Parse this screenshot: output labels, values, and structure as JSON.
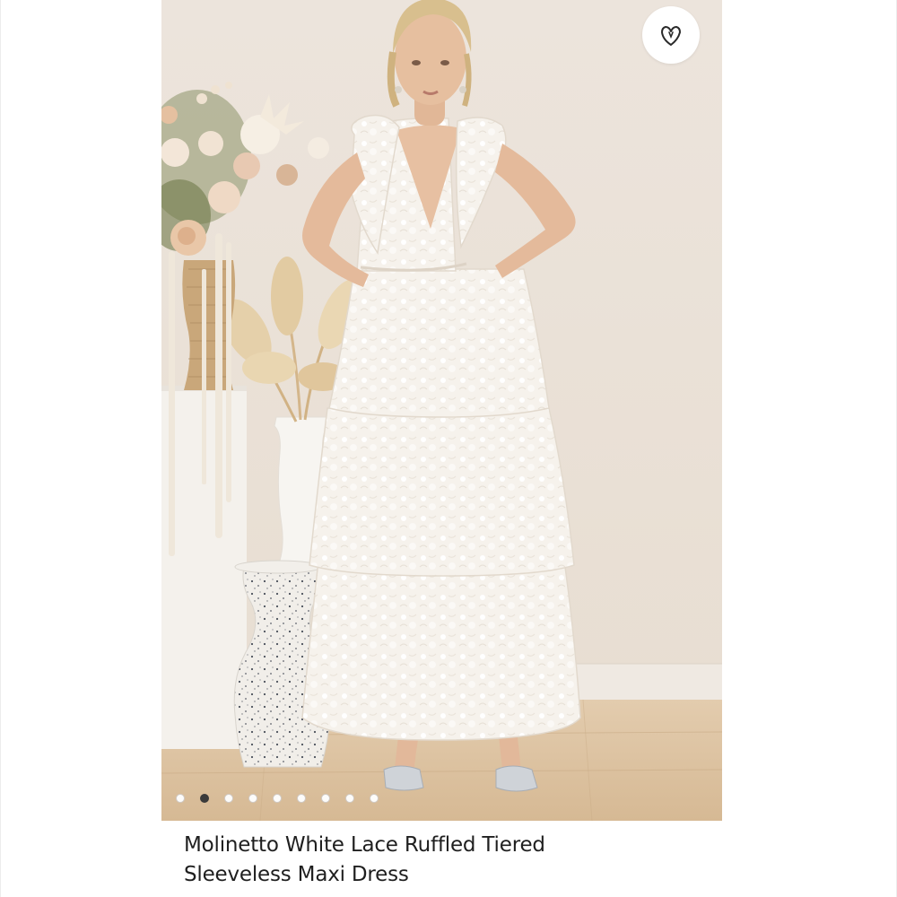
{
  "product": {
    "title_line1": "Molinetto White Lace Ruffled Tiered",
    "title_line2": "Sleeveless Maxi Dress"
  },
  "gallery": {
    "image_count": 9,
    "active_index": 1
  },
  "icons": {
    "favorite": "heart-icon"
  },
  "colors": {
    "wall": "#ebe3db",
    "floor": "#d9bf9f",
    "dress": "#f7f3ee",
    "active_dot": "#3a3a3a"
  }
}
